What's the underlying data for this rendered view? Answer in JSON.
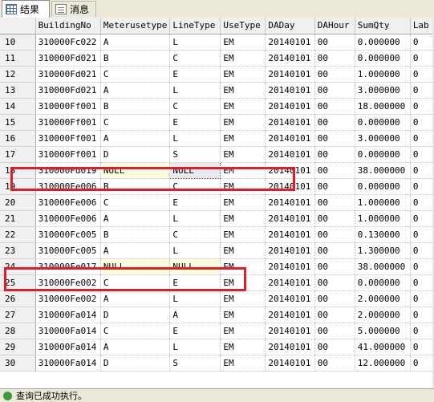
{
  "tabs": [
    {
      "label": "结果",
      "icon": "results-grid-icon"
    },
    {
      "label": "消息",
      "icon": "messages-icon"
    }
  ],
  "columns": [
    "",
    "BuildingNo",
    "Meterusetype",
    "LineType",
    "UseType",
    "DADay",
    "DAHour",
    "SumQty",
    "Lab"
  ],
  "rows": [
    [
      "10",
      "310000Fc022",
      "A",
      "L",
      "EM",
      "20140101",
      "00",
      "0.000000",
      "0"
    ],
    [
      "11",
      "310000Fd021",
      "B",
      "C",
      "EM",
      "20140101",
      "00",
      "0.000000",
      "0"
    ],
    [
      "12",
      "310000Fd021",
      "C",
      "E",
      "EM",
      "20140101",
      "00",
      "1.000000",
      "0"
    ],
    [
      "13",
      "310000Fd021",
      "A",
      "L",
      "EM",
      "20140101",
      "00",
      "3.000000",
      "0"
    ],
    [
      "14",
      "310000Ff001",
      "B",
      "C",
      "EM",
      "20140101",
      "00",
      "18.000000",
      "0"
    ],
    [
      "15",
      "310000Ff001",
      "C",
      "E",
      "EM",
      "20140101",
      "00",
      "0.000000",
      "0"
    ],
    [
      "16",
      "310000Ff001",
      "A",
      "L",
      "EM",
      "20140101",
      "00",
      "3.000000",
      "0"
    ],
    [
      "17",
      "310000Ff001",
      "D",
      "S",
      "EM",
      "20140101",
      "00",
      "0.000000",
      "0"
    ],
    [
      "18",
      "310000Fd019",
      "NULL",
      "NULL",
      "EM",
      "20140101",
      "00",
      "38.000000",
      "0"
    ],
    [
      "19",
      "310000Fe006",
      "B",
      "C",
      "EM",
      "20140101",
      "00",
      "0.000000",
      "0"
    ],
    [
      "20",
      "310000Fe006",
      "C",
      "E",
      "EM",
      "20140101",
      "00",
      "1.000000",
      "0"
    ],
    [
      "21",
      "310000Fe006",
      "A",
      "L",
      "EM",
      "20140101",
      "00",
      "1.000000",
      "0"
    ],
    [
      "22",
      "310000Fc005",
      "B",
      "C",
      "EM",
      "20140101",
      "00",
      "0.130000",
      "0"
    ],
    [
      "23",
      "310000Fc005",
      "A",
      "L",
      "EM",
      "20140101",
      "00",
      "1.300000",
      "0"
    ],
    [
      "24",
      "310000Fe017",
      "NULL",
      "NULL",
      "EM",
      "20140101",
      "00",
      "38.000000",
      "0"
    ],
    [
      "25",
      "310000Fe002",
      "C",
      "E",
      "EM",
      "20140101",
      "00",
      "0.000000",
      "0"
    ],
    [
      "26",
      "310000Fe002",
      "A",
      "L",
      "EM",
      "20140101",
      "00",
      "2.000000",
      "0"
    ],
    [
      "27",
      "310000Fa014",
      "D",
      "A",
      "EM",
      "20140101",
      "00",
      "2.000000",
      "0"
    ],
    [
      "28",
      "310000Fa014",
      "C",
      "E",
      "EM",
      "20140101",
      "00",
      "5.000000",
      "0"
    ],
    [
      "29",
      "310000Fa014",
      "A",
      "L",
      "EM",
      "20140101",
      "00",
      "41.000000",
      "0"
    ],
    [
      "30",
      "310000Fa014",
      "D",
      "S",
      "EM",
      "20140101",
      "00",
      "12.000000",
      "0"
    ]
  ],
  "status": {
    "text": "查询已成功执行。"
  },
  "colors": {
    "highlight": "#e01e28",
    "null_bg": "#ffffe1"
  }
}
